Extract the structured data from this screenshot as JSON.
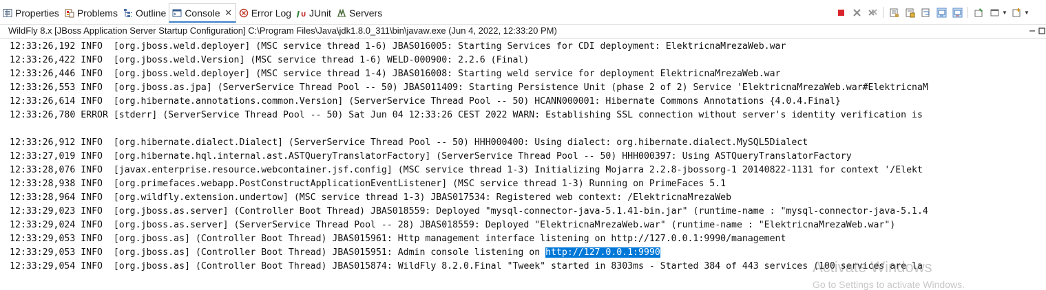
{
  "tabs": [
    {
      "label": "Properties",
      "icon": "properties-icon"
    },
    {
      "label": "Problems",
      "icon": "problems-icon"
    },
    {
      "label": "Outline",
      "icon": "outline-icon"
    },
    {
      "label": "Console",
      "icon": "console-icon",
      "active": true
    },
    {
      "label": "Error Log",
      "icon": "error-log-icon"
    },
    {
      "label": "JUnit",
      "icon": "junit-icon"
    },
    {
      "label": "Servers",
      "icon": "servers-icon"
    }
  ],
  "console_tab_close": "✕",
  "description": "WildFly 8.x [JBoss Application Server Startup Configuration] C:\\Program Files\\Java\\jdk1.8.0_311\\bin\\javaw.exe  (Jun 4, 2022, 12:33:20 PM)",
  "colors": {
    "selection": "#0078d7",
    "active_tab_underline": "#3d7fc8",
    "terminate_red": "#d9252c"
  },
  "lines": [
    "12:33:26,192 INFO  [org.jboss.weld.deployer] (MSC service thread 1-6) JBAS016005: Starting Services for CDI deployment: ElektricnaMrezaWeb.war",
    "12:33:26,422 INFO  [org.jboss.weld.Version] (MSC service thread 1-6) WELD-000900: 2.2.6 (Final)",
    "12:33:26,446 INFO  [org.jboss.weld.deployer] (MSC service thread 1-4) JBAS016008: Starting weld service for deployment ElektricnaMrezaWeb.war",
    "12:33:26,553 INFO  [org.jboss.as.jpa] (ServerService Thread Pool -- 50) JBAS011409: Starting Persistence Unit (phase 2 of 2) Service 'ElektricnaMrezaWeb.war#ElektricnaM",
    "12:33:26,614 INFO  [org.hibernate.annotations.common.Version] (ServerService Thread Pool -- 50) HCANN000001: Hibernate Commons Annotations {4.0.4.Final}",
    "12:33:26,780 ERROR [stderr] (ServerService Thread Pool -- 50) Sat Jun 04 12:33:26 CEST 2022 WARN: Establishing SSL connection without server's identity verification is",
    "",
    "12:33:26,912 INFO  [org.hibernate.dialect.Dialect] (ServerService Thread Pool -- 50) HHH000400: Using dialect: org.hibernate.dialect.MySQL5Dialect",
    "12:33:27,019 INFO  [org.hibernate.hql.internal.ast.ASTQueryTranslatorFactory] (ServerService Thread Pool -- 50) HHH000397: Using ASTQueryTranslatorFactory",
    "12:33:28,076 INFO  [javax.enterprise.resource.webcontainer.jsf.config] (MSC service thread 1-3) Initializing Mojarra 2.2.8-jbossorg-1 20140822-1131 for context '/Elekt",
    "12:33:28,938 INFO  [org.primefaces.webapp.PostConstructApplicationEventListener] (MSC service thread 1-3) Running on PrimeFaces 5.1",
    "12:33:28,964 INFO  [org.wildfly.extension.undertow] (MSC service thread 1-3) JBAS017534: Registered web context: /ElektricnaMrezaWeb",
    "12:33:29,023 INFO  [org.jboss.as.server] (Controller Boot Thread) JBAS018559: Deployed \"mysql-connector-java-5.1.41-bin.jar\" (runtime-name : \"mysql-connector-java-5.1.4",
    "12:33:29,024 INFO  [org.jboss.as.server] (ServerService Thread Pool -- 28) JBAS018559: Deployed \"ElektricnaMrezaWeb.war\" (runtime-name : \"ElektricnaMrezaWeb.war\")",
    "12:33:29,053 INFO  [org.jboss.as] (Controller Boot Thread) JBAS015961: Http management interface listening on http://127.0.0.1:9990/management"
  ],
  "admin_line": {
    "prefix": "12:33:29,053 INFO  [org.jboss.as] (Controller Boot Thread) JBAS015951: Admin console listening on ",
    "link": "http://127.0.0.1:9990"
  },
  "last_line": "12:33:29,054 INFO  [org.jboss.as] (Controller Boot Thread) JBAS015874: WildFly 8.2.0.Final \"Tweek\" started in 8303ms - Started 384 of 443 services (100 services are la",
  "watermark": {
    "title": "Activate Windows",
    "subtitle": "Go to Settings to activate Windows."
  }
}
